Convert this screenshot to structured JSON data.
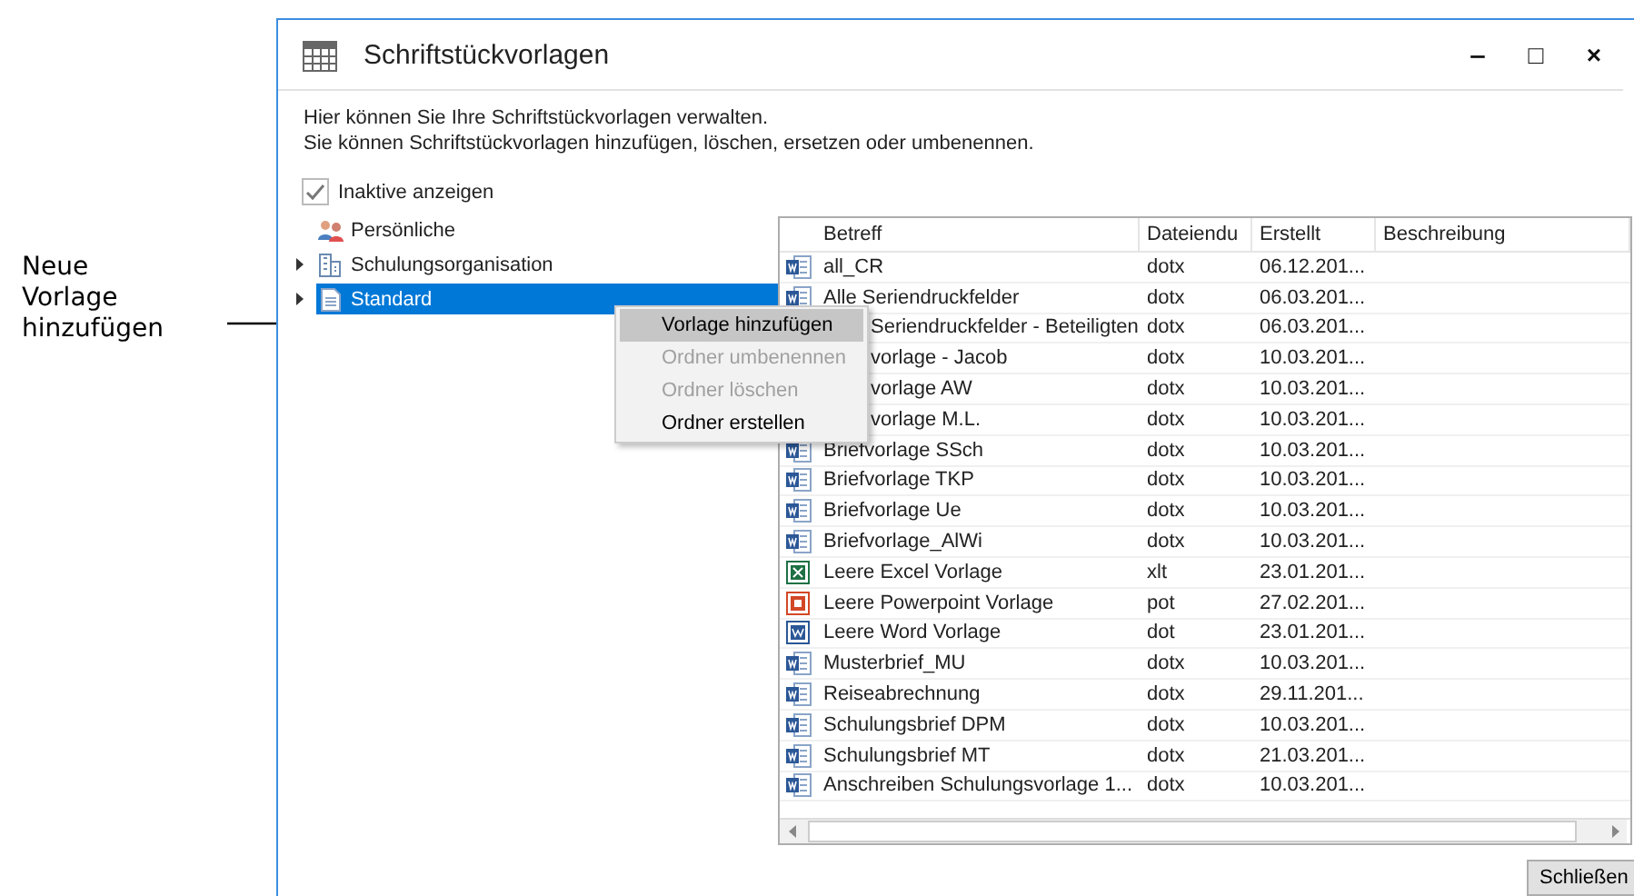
{
  "annotation": {
    "text": "Neue Vorlage hinzufügen"
  },
  "window": {
    "title": "Schriftstückvorlagen",
    "controls": [
      "‒",
      "□",
      "×"
    ]
  },
  "intro": [
    "Hier können Sie Ihre Schriftstückvorlagen verwalten.",
    "Sie können Schriftstückvorlagen hinzufügen, löschen, ersetzen oder umbenennen."
  ],
  "show_inactive": {
    "label": "Inaktive anzeigen",
    "checked": true
  },
  "tree": {
    "items": [
      {
        "label": "Persönliche",
        "kind": "people",
        "expandable": false,
        "selected": false
      },
      {
        "label": "Schulungsorganisation",
        "kind": "building",
        "expandable": true,
        "selected": false
      },
      {
        "label": "Standard",
        "kind": "document",
        "expandable": true,
        "selected": true
      }
    ]
  },
  "context_menu": {
    "items": [
      {
        "label": "Vorlage hinzufügen",
        "selected": true,
        "disabled": false
      },
      {
        "label": "Ordner umbenennen",
        "selected": false,
        "disabled": true
      },
      {
        "label": "Ordner löschen",
        "selected": false,
        "disabled": true
      },
      {
        "label": "Ordner erstellen",
        "selected": false,
        "disabled": false
      }
    ]
  },
  "table": {
    "columns": [
      "Betreff",
      "Dateiendu",
      "Erstellt",
      "Beschreibung"
    ],
    "rows": [
      {
        "kind": "word-template",
        "cells": [
          "all_CR",
          "dotx",
          "06.12.201..."
        ]
      },
      {
        "kind": "word-template",
        "cells": [
          "Alle Seriendruckfelder",
          "dotx",
          "06.03.201..."
        ]
      },
      {
        "cells": [
          "Seriendruckfelder - Beteiligten",
          "dotx",
          "06.03.201..."
        ]
      },
      {
        "cells": [
          "vorlage - Jacob",
          "dotx",
          "10.03.201..."
        ]
      },
      {
        "cells": [
          "vorlage AW",
          "dotx",
          "10.03.201..."
        ]
      },
      {
        "cells": [
          "vorlage M.L.",
          "dotx",
          "10.03.201..."
        ]
      },
      {
        "kind": "word-template",
        "cells": [
          "Briefvorlage SSch",
          "dotx",
          "10.03.201..."
        ]
      },
      {
        "kind": "word-template",
        "cells": [
          "Briefvorlage TKP",
          "dotx",
          "10.03.201..."
        ]
      },
      {
        "kind": "word-template",
        "cells": [
          "Briefvorlage Ue",
          "dotx",
          "10.03.201..."
        ]
      },
      {
        "kind": "word-template",
        "cells": [
          "Briefvorlage_AlWi",
          "dotx",
          "10.03.201..."
        ]
      },
      {
        "kind": "excel",
        "cells": [
          "Leere Excel Vorlage",
          "xlt",
          "23.01.201..."
        ]
      },
      {
        "kind": "powerpoint",
        "cells": [
          "Leere Powerpoint Vorlage",
          "pot",
          "27.02.201..."
        ]
      },
      {
        "kind": "word",
        "cells": [
          "Leere Word Vorlage",
          "dot",
          "23.01.201..."
        ]
      },
      {
        "kind": "word-template",
        "cells": [
          "Musterbrief_MU",
          "dotx",
          "10.03.201..."
        ]
      },
      {
        "kind": "word-template",
        "cells": [
          "Reiseabrechnung",
          "dotx",
          "29.11.201..."
        ]
      },
      {
        "kind": "word-template",
        "cells": [
          "Schulungsbrief DPM",
          "dotx",
          "10.03.201..."
        ]
      },
      {
        "kind": "word-template",
        "cells": [
          "Schulungsbrief MT",
          "dotx",
          "21.03.201..."
        ]
      },
      {
        "kind": "word-template",
        "cells": [
          "Anschreiben Schulungsvorlage 1...",
          "dotx",
          "10.03.201..."
        ]
      }
    ]
  },
  "buttons": [
    "Schließen"
  ]
}
